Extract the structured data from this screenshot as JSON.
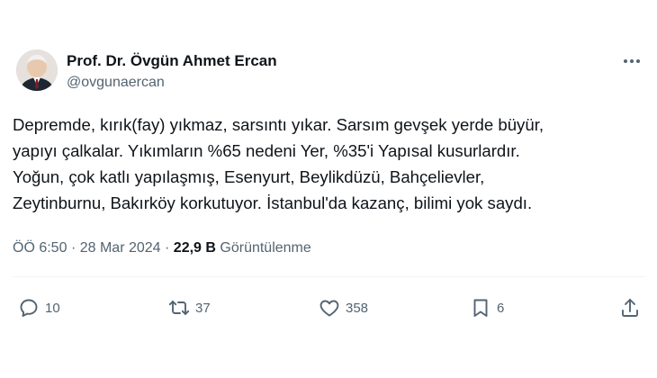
{
  "author": {
    "name": "Prof. Dr. Övgün Ahmet Ercan",
    "handle": "@ovgunaercan"
  },
  "tweet": {
    "lines": [
      "Depremde, kırık(fay) yıkmaz, sarsıntı yıkar. Sarsım gevşek yerde büyür,",
      "yapıyı çalkalar. Yıkımların %65 nedeni Yer, %35'i Yapısal kusurlardır.",
      "Yoğun, çok katlı yapılaşmış, Esenyurt, Beylikdüzü, Bahçelievler,",
      "Zeytinburnu, Bakırköy korkutuyor. İstanbul'da kazanç, bilimi yok saydı."
    ]
  },
  "meta": {
    "time": "ÖÖ 6:50",
    "separator": "·",
    "date": "28 Mar 2024",
    "views_count": "22,9 B",
    "views_label": "Görüntülenme"
  },
  "actions": {
    "replies": "10",
    "retweets": "37",
    "likes": "358",
    "bookmarks": "6"
  },
  "icons": [
    "avatar",
    "more-icon",
    "reply-icon",
    "retweet-icon",
    "like-icon",
    "bookmark-icon",
    "share-icon"
  ],
  "colors": {
    "text": "#0f1419",
    "secondary": "#536471",
    "divider": "#eff3f4"
  }
}
